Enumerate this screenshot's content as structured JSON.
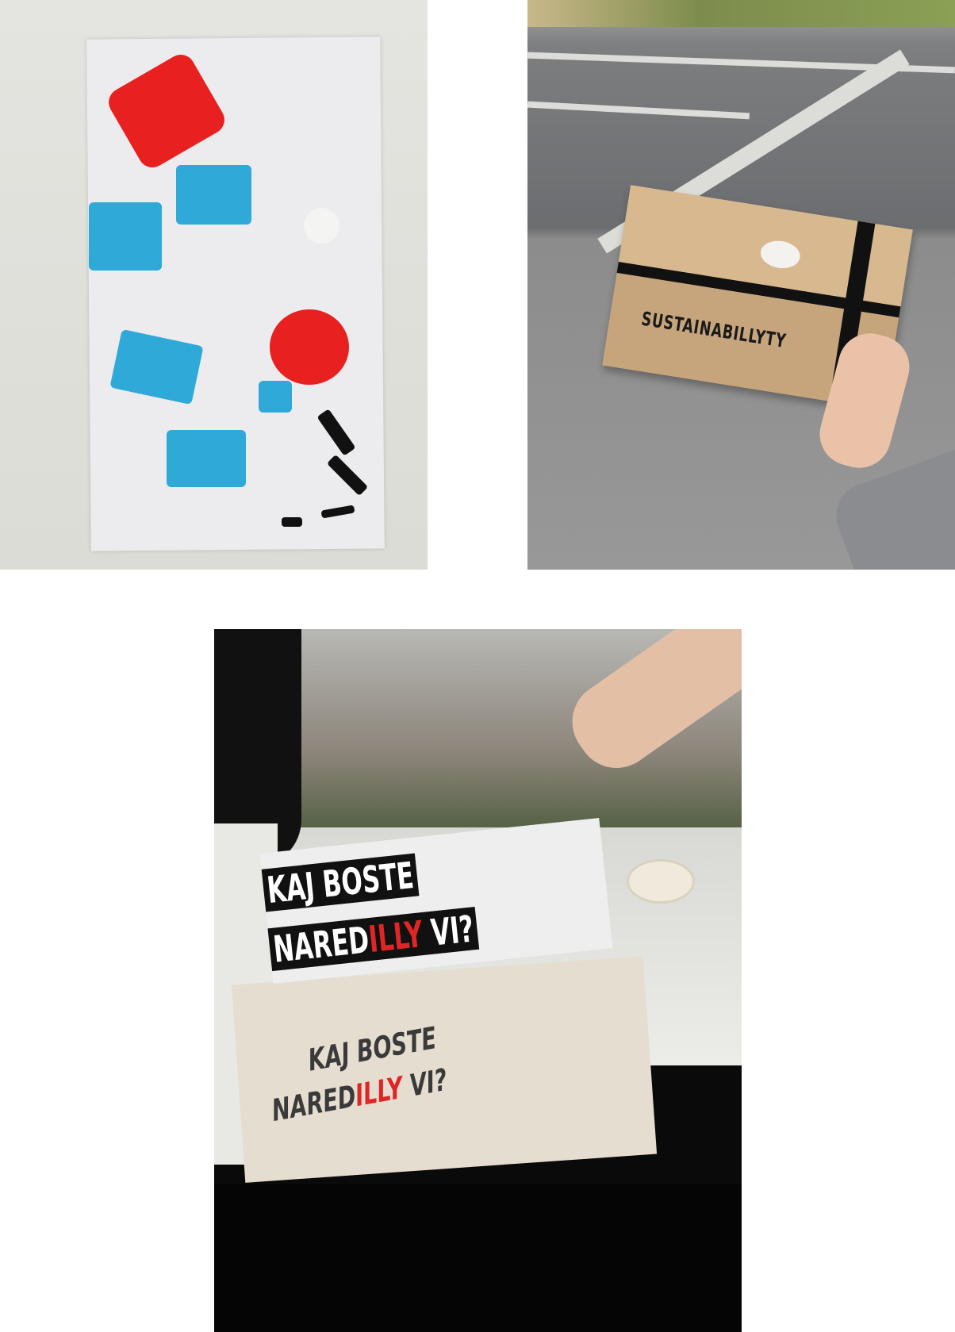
{
  "photos": [
    {
      "subject": "Stencil sheet with blue sponges and red and black paint"
    },
    {
      "subject": "Cardboard gift box with black ribbon held over a street",
      "box_text": "SUSTAINABILLYTY"
    },
    {
      "subject": "Stencil and printed tote bag on a windowsill",
      "stencil_line1": "KAJ BOSTE",
      "stencil_line2_a": "NARED",
      "stencil_line2_b": "ILLY",
      "stencil_line2_c": " VI?",
      "bag_line1": "KAJ BOSTE",
      "bag_line2_a": "NARED",
      "bag_line2_b": "ILLY",
      "bag_line2_c": " VI?"
    }
  ],
  "colors": {
    "paint_red": "#e82020",
    "sponge_blue": "#2fa9d8",
    "ink_black": "#111111"
  }
}
